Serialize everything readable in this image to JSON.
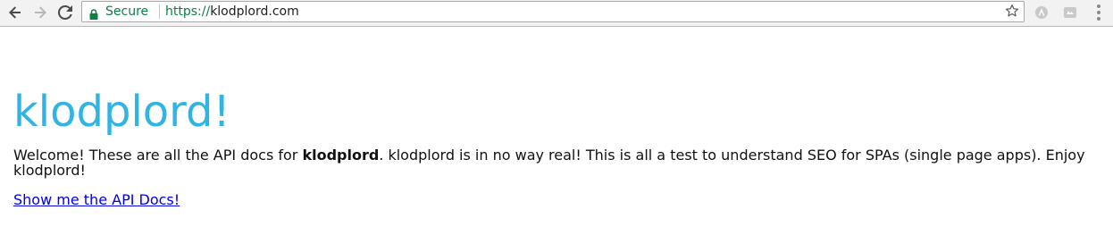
{
  "browser": {
    "security_label": "Secure",
    "url_scheme": "https://",
    "url_host": "klodplord.com",
    "icons": {
      "back": "back-arrow-icon",
      "forward": "forward-arrow-icon",
      "reload": "reload-icon",
      "lock": "lock-icon",
      "bookmark": "star-icon",
      "extension_1": "extension-icon",
      "extension_2": "extension-icon",
      "menu": "kebab-menu-icon"
    },
    "colors": {
      "secure": "#0b8043",
      "toolbar": "#f2f2f2"
    }
  },
  "page": {
    "title": "klodplord!",
    "intro_before": "Welcome! These are all the API docs for ",
    "intro_bold": "klodplord",
    "intro_after": ". klodplord is in no way real! This is all a test to understand SEO for SPAs (single page apps). Enjoy klodplord!",
    "link_label": "Show me the API Docs!",
    "colors": {
      "title": "#2fb4e4",
      "link": "#0000ee"
    }
  }
}
